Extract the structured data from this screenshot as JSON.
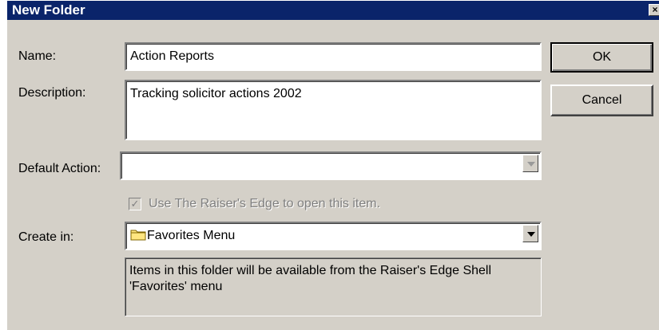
{
  "window": {
    "title": "New Folder",
    "close_glyph": "×"
  },
  "form": {
    "name_label": "Name:",
    "name_value": "Action Reports",
    "description_label": "Description:",
    "description_value": "Tracking solicitor actions 2002",
    "default_action_label": "Default Action:",
    "default_action_value": "",
    "use_re_checkbox_label": "Use The Raiser's Edge to open this item.",
    "use_re_checkbox_checked": true,
    "create_in_label": "Create in:",
    "create_in_value": "Favorites Menu",
    "info_text": "Items in this folder will be available from the Raiser's Edge Shell 'Favorites' menu"
  },
  "buttons": {
    "ok_label": "OK",
    "cancel_label": "Cancel"
  },
  "icons": {
    "folder": "folder-icon",
    "dropdown": "chevron-down-icon",
    "close": "close-icon",
    "check": "check-icon"
  },
  "colors": {
    "titlebar": "#0a246a",
    "dialog_face": "#d4d0c8",
    "field_bg": "#ffffff",
    "disabled_text": "#808080",
    "folder_fill": "#ffe680"
  }
}
